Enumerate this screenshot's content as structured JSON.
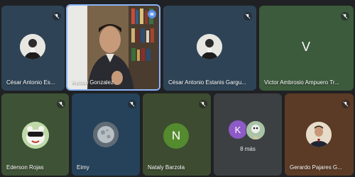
{
  "participants": [
    {
      "name": "César Antonio Es...",
      "muted": true
    },
    {
      "name": "Ayrton Gonzalez",
      "speaking": true
    },
    {
      "name": "César Antonio Estanis Gargu...",
      "muted": true
    },
    {
      "name": "Victor Ambrosio Ampuero Tr...",
      "muted": true,
      "initial": "V"
    },
    {
      "name": "Ederson Rojas",
      "muted": true
    },
    {
      "name": "Eimy",
      "muted": true
    },
    {
      "name": "Nataly Barzola",
      "muted": true,
      "initial": "N"
    },
    {
      "name": "Gerardo Pajares G...",
      "muted": true
    }
  ],
  "overflow": {
    "initial": "K",
    "label": "8 más"
  },
  "colors": {
    "background": "#202124",
    "tile": "#3c4043",
    "speaking_border": "#8ab4f8",
    "victor_tile": "#3c5a3c",
    "nataly_tile": "#3d4c30",
    "ederson_tile": "#3e5335",
    "eimy_tile": "#25425a",
    "gerardo_tile": "#5b3b25",
    "nataly_avatar": "#558b2f",
    "overflow_avatar": "#8e5ac8"
  }
}
